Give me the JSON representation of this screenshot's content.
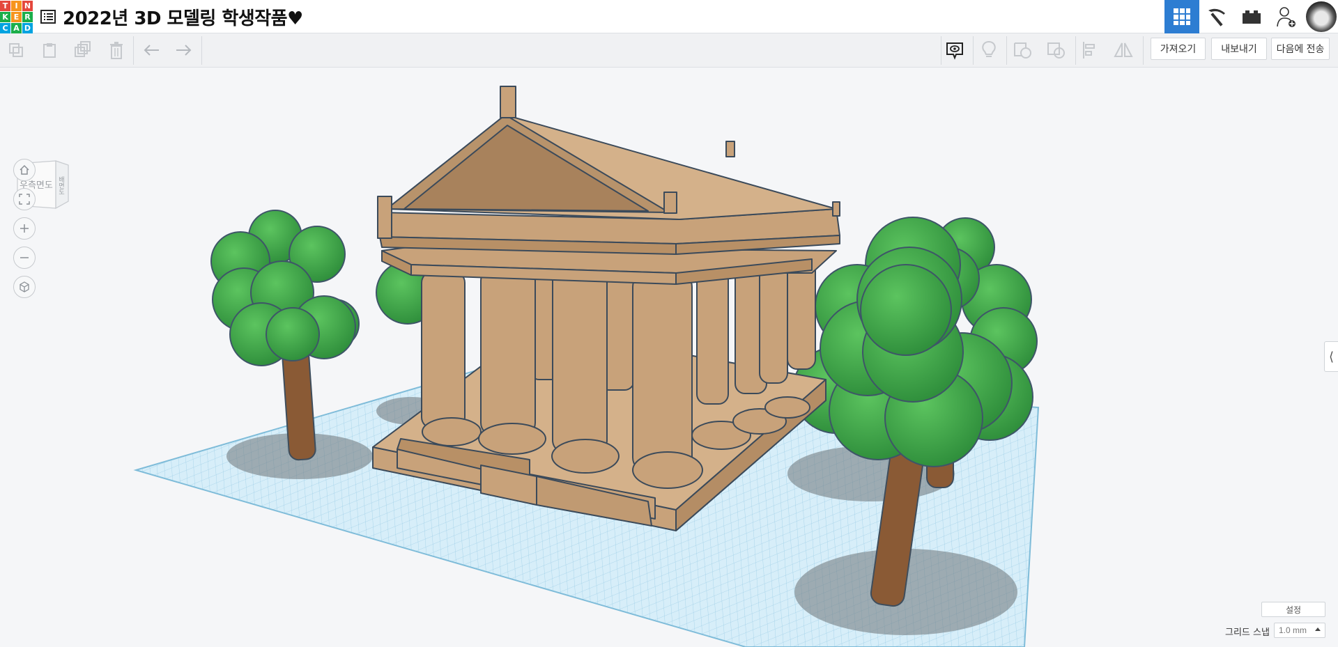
{
  "app": {
    "logo_letters": [
      "T",
      "I",
      "N",
      "K",
      "E",
      "R",
      "C",
      "A",
      "D"
    ],
    "logo_colors": [
      "#e4473c",
      "#f7941d",
      "#e4473c",
      "#1bae4a",
      "#f7941d",
      "#1bae4a",
      "#00a3e0",
      "#1bae4a",
      "#00a3e0"
    ],
    "title": "2022년 3D 모델링 학생작품♥"
  },
  "topnav": {
    "items": [
      {
        "name": "3d-design-view",
        "icon": "grid-icon",
        "active": true
      },
      {
        "name": "minecraft-view",
        "icon": "pickaxe-icon",
        "active": false
      },
      {
        "name": "bricks-view",
        "icon": "brick-icon",
        "active": false
      },
      {
        "name": "invite-user",
        "icon": "add-user-icon",
        "active": false
      },
      {
        "name": "profile",
        "icon": "avatar-icon",
        "active": false
      }
    ],
    "accent": "#2d7dd2"
  },
  "toolbar": {
    "copy_icon": "copy-icon",
    "paste_icon": "paste-icon",
    "duplicate_icon": "duplicate-icon",
    "delete_icon": "trash-icon",
    "undo_icon": "undo-icon",
    "redo_icon": "redo-icon",
    "notes_icon": "notes-icon",
    "light_icon": "bulb-icon",
    "shape_icon": "shape-icon",
    "group_icon": "group-icon",
    "align_icon": "align-icon",
    "mirror_icon": "mirror-icon",
    "import_label": "가져오기",
    "export_label": "내보내기",
    "send_to_label": "다음에 전송"
  },
  "viewport": {
    "viewcube_label_front": "우측면도",
    "viewcube_label_side": "배면도",
    "nav_icons": [
      "home-icon",
      "fit-icon",
      "zoom-in-icon",
      "zoom-out-icon",
      "perspective-icon"
    ],
    "settings_label": "설정",
    "grid_snap_label": "그리드 스냅",
    "grid_snap_value": "1.0 mm",
    "colors": {
      "workplane": "#cfe8f5",
      "grid_line": "#8cc6e2",
      "building": "#c8a27a",
      "foliage": "#3da64a",
      "trunk": "#8a5a35"
    }
  }
}
